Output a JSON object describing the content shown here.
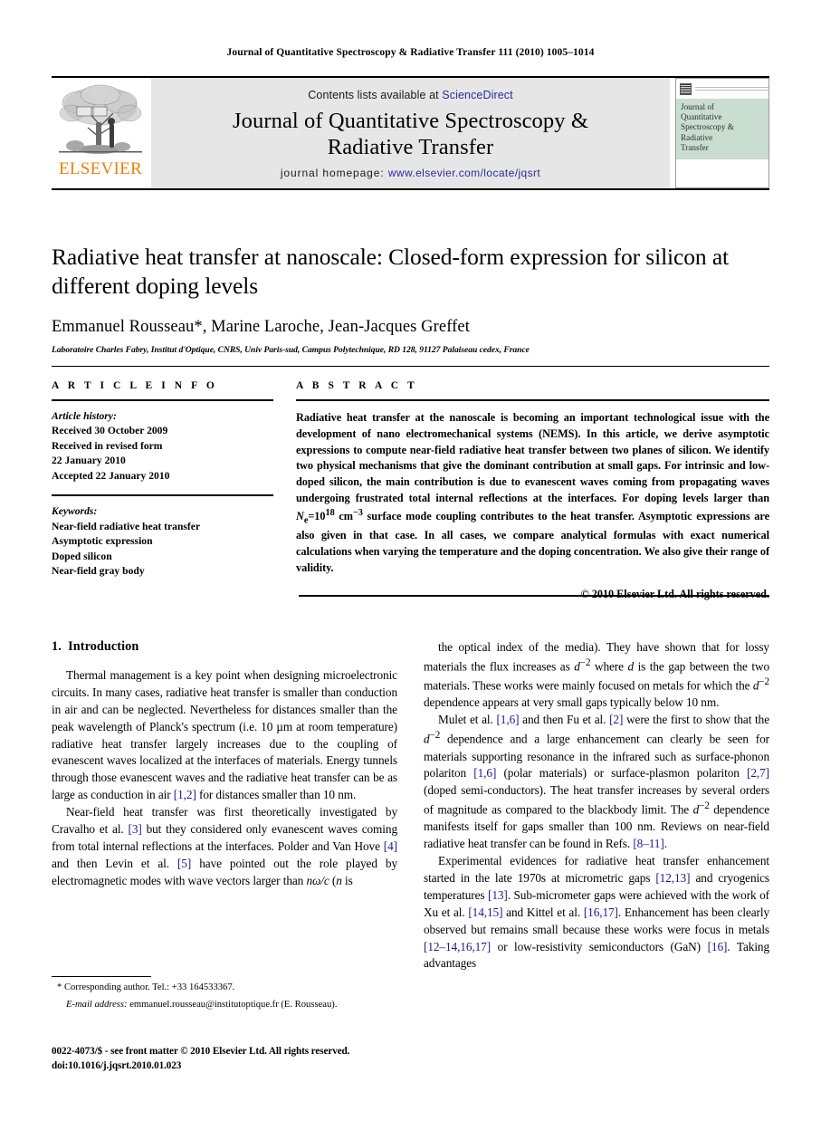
{
  "running_head": "Journal of Quantitative Spectroscopy & Radiative Transfer 111 (2010) 1005–1014",
  "masthead": {
    "publisher_name": "ELSEVIER",
    "publisher_logo": "elsevier-tree-logo",
    "contents_prefix": "Contents lists available at ",
    "contents_link": "ScienceDirect",
    "journal_title_line1": "Journal of Quantitative Spectroscopy &",
    "journal_title_line2": "Radiative Transfer",
    "homepage_prefix": "journal homepage: ",
    "homepage_link": "www.elsevier.com/locate/jqsrt",
    "cover": {
      "lines": [
        "Journal of",
        "Quantitative",
        "Spectroscopy &",
        "Radiative",
        "Transfer"
      ]
    }
  },
  "title_block": {
    "title": "Radiative heat transfer at nanoscale: Closed-form expression for silicon at different doping levels",
    "authors": "Emmanuel Rousseau*, Marine Laroche, Jean-Jacques Greffet",
    "affiliation": "Laboratoire Charles Fabry, Institut d'Optique, CNRS, Univ Paris-sud, Campus Polytechnique, RD 128, 91127 Palaiseau cedex, France"
  },
  "article_info": {
    "heading": "A R T I C L E   I N F O",
    "history_label": "Article history:",
    "history_lines": [
      "Received 30 October 2009",
      "Received in revised form",
      "22 January 2010",
      "Accepted 22 January 2010"
    ],
    "keywords_label": "Keywords:",
    "keywords": [
      "Near-field radiative heat transfer",
      "Asymptotic expression",
      "Doped silicon",
      "Near-field gray body"
    ]
  },
  "abstract": {
    "heading": "A B S T R A C T",
    "text_part1": "Radiative heat transfer at the nanoscale is becoming an important technological issue with the development of nano electromechanical systems (NEMS). In this article, we derive asymptotic expressions to compute near-field radiative heat transfer between two planes of silicon. We identify two physical mechanisms that give the dominant contribution at small gaps. For intrinsic and low-doped silicon, the main contribution is due to evanescent waves coming from propagating waves undergoing frustrated total internal reflections at the interfaces. For doping levels larger than ",
    "formula_var": "N",
    "formula_sub": "e",
    "formula_eq": "=10",
    "formula_sup": "18",
    "formula_unit": " cm",
    "formula_unit_sup": "−3",
    "text_part2": " surface mode coupling contributes to the heat transfer. Asymptotic expressions are also given in that case. In all cases, we compare analytical formulas with exact numerical calculations when varying the temperature and the doping concentration. We also give their range of validity.",
    "copyright": "© 2010 Elsevier Ltd. All rights reserved."
  },
  "body": {
    "section_number": "1.",
    "section_title": "Introduction",
    "left_paragraphs": [
      {
        "id": "p1",
        "segments": [
          {
            "t": "Thermal management is a key point when designing microelectronic circuits. In many cases, radiative heat transfer is smaller than conduction in air and can be neglected. Nevertheless for distances smaller than the peak wavelength of Planck's spectrum (i.e. 10 µm at room temperature) radiative heat transfer largely increases due to the coupling of evanescent waves localized at the interfaces of materials. Energy tunnels through those evanescent waves and the radiative heat transfer can be as large as conduction in air "
          },
          {
            "t": "[1,2]",
            "cite": true
          },
          {
            "t": " for distances smaller than 10 nm."
          }
        ]
      },
      {
        "id": "p2",
        "segments": [
          {
            "t": "Near-field heat transfer was first theoretically investigated by Cravalho et al. "
          },
          {
            "t": "[3]",
            "cite": true
          },
          {
            "t": " but they considered only evanescent waves coming from total internal reflections at the interfaces. Polder and Van Hove "
          },
          {
            "t": "[4]",
            "cite": true
          },
          {
            "t": " and then Levin et al. "
          },
          {
            "t": "[5]",
            "cite": true
          },
          {
            "t": " have pointed out the role played by electromagnetic modes with wave vectors larger than "
          },
          {
            "t": "nω/c",
            "italic": true
          },
          {
            "t": " ("
          },
          {
            "t": "n",
            "italic": true
          },
          {
            "t": " is"
          }
        ]
      }
    ],
    "right_paragraphs": [
      {
        "id": "p3",
        "segments": [
          {
            "t": "the optical index of the media). They have shown that for lossy materials the flux increases as "
          },
          {
            "t": "d",
            "italic": true,
            "sup": "−2"
          },
          {
            "t": " where "
          },
          {
            "t": "d",
            "italic": true
          },
          {
            "t": " is the gap between the two materials. These works were mainly focused on metals for which the "
          },
          {
            "t": "d",
            "italic": true,
            "sup": "−2"
          },
          {
            "t": " dependence appears at very small gaps typically below 10 nm."
          }
        ]
      },
      {
        "id": "p4",
        "segments": [
          {
            "t": "Mulet et al. "
          },
          {
            "t": "[1,6]",
            "cite": true
          },
          {
            "t": " and then Fu et al. "
          },
          {
            "t": "[2]",
            "cite": true
          },
          {
            "t": " were the first to show that the "
          },
          {
            "t": "d",
            "italic": true,
            "sup": "−2"
          },
          {
            "t": " dependence and a large enhancement can clearly be seen for materials supporting resonance in the infrared such as surface-phonon polariton "
          },
          {
            "t": "[1,6]",
            "cite": true
          },
          {
            "t": " (polar materials) or surface-plasmon polariton "
          },
          {
            "t": "[2,7]",
            "cite": true
          },
          {
            "t": " (doped semi-conductors). The heat transfer increases by several orders of magnitude as compared to the blackbody limit. The "
          },
          {
            "t": "d",
            "italic": true,
            "sup": "−2"
          },
          {
            "t": " dependence manifests itself for gaps smaller than 100 nm. Reviews on near-field radiative heat transfer can be found in Refs. "
          },
          {
            "t": "[8–11]",
            "cite": true
          },
          {
            "t": "."
          }
        ]
      },
      {
        "id": "p5",
        "segments": [
          {
            "t": "Experimental evidences for radiative heat transfer enhancement started in the late 1970s at micrometric gaps "
          },
          {
            "t": "[12,13]",
            "cite": true
          },
          {
            "t": " and cryogenics temperatures "
          },
          {
            "t": "[13]",
            "cite": true
          },
          {
            "t": ". Sub-micrometer gaps were achieved with the work of Xu et al. "
          },
          {
            "t": "[14,15]",
            "cite": true
          },
          {
            "t": " and Kittel et al. "
          },
          {
            "t": "[16,17]",
            "cite": true
          },
          {
            "t": ". Enhancement has been clearly observed but remains small because these works were focus in metals "
          },
          {
            "t": "[12–14,16,17]",
            "cite": true
          },
          {
            "t": " or low-resistivity semiconductors (GaN) "
          },
          {
            "t": "[16]",
            "cite": true
          },
          {
            "t": ". Taking advantages"
          }
        ]
      }
    ]
  },
  "footnotes": {
    "corresponding": "* Corresponding author. Tel.: +33 164533367.",
    "email_label": "E-mail address:",
    "email_value": " emmanuel.rousseau@institutoptique.fr (E. Rousseau).",
    "imprint_line1": "0022-4073/$ - see front matter © 2010 Elsevier Ltd. All rights reserved.",
    "imprint_line2": "doi:10.1016/j.jqsrt.2010.01.023"
  },
  "colors": {
    "link_blue": "#2b2b9c",
    "cite_blue": "#1a1a8c",
    "elsevier_orange": "#E8820C",
    "band_gray": "#e6e6e6",
    "cover_green": "#c9ded0"
  }
}
